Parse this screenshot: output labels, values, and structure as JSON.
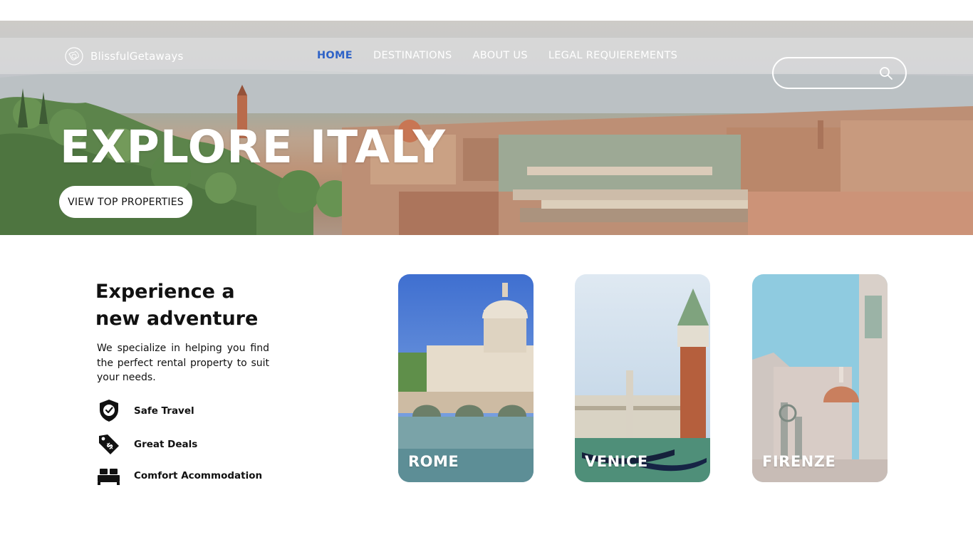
{
  "brand": {
    "name": "BlissfulGetaways"
  },
  "nav": {
    "items": [
      {
        "label": "HOME",
        "active": true
      },
      {
        "label": "DESTINATIONS",
        "active": false
      },
      {
        "label": "ABOUT US",
        "active": false
      },
      {
        "label": "LEGAL REQUIEREMENTS",
        "active": false
      }
    ]
  },
  "search": {
    "value": "",
    "icon": "search-icon"
  },
  "hero": {
    "title": "EXPLORE ITALY",
    "cta_label": "VIEW TOP PROPERTIES"
  },
  "intro": {
    "heading": "Experience a new adventure",
    "body": "We specialize in helping you find the perfect rental property to suit your needs."
  },
  "features": [
    {
      "label": "Safe Travel",
      "icon": "shield-check-icon"
    },
    {
      "label": "Great Deals",
      "icon": "price-tag-icon"
    },
    {
      "label": "Comfort Acommodation",
      "icon": "bed-icon"
    }
  ],
  "destinations": [
    {
      "label": "ROME"
    },
    {
      "label": "VENICE"
    },
    {
      "label": "FIRENZE"
    }
  ],
  "colors": {
    "accent": "#2f63c7",
    "text": "#111111",
    "white": "#ffffff"
  }
}
